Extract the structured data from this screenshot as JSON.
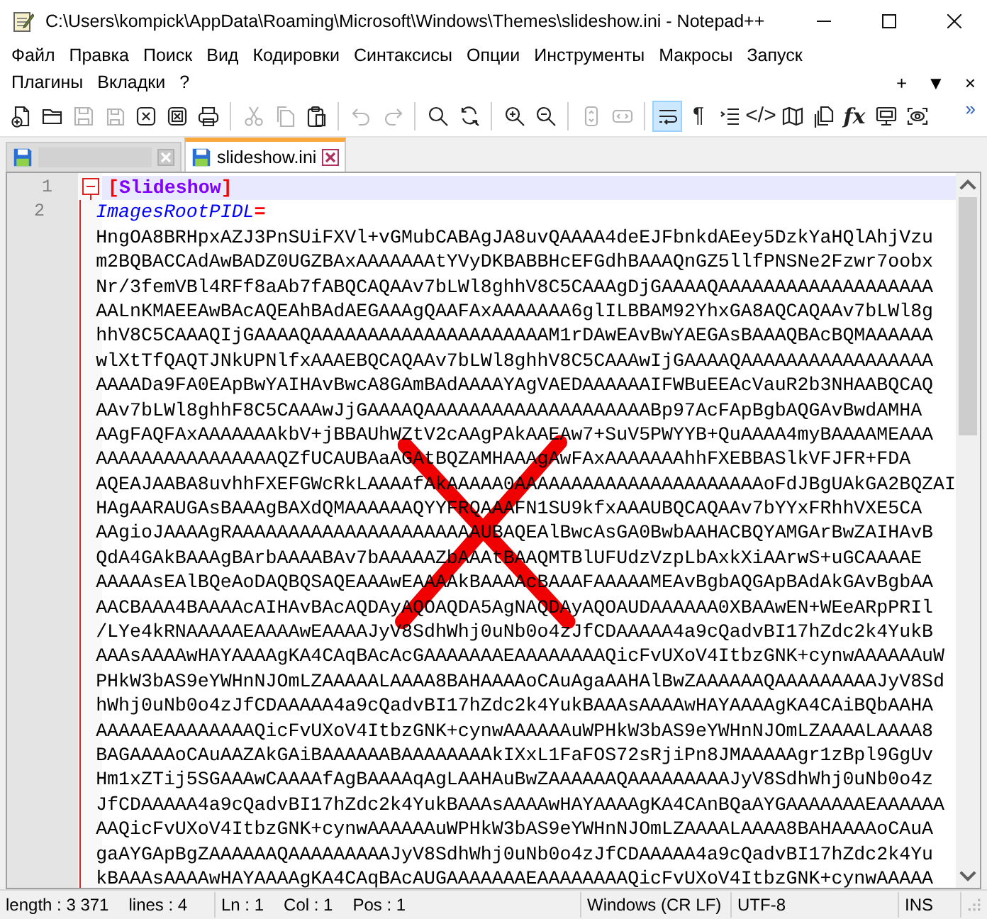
{
  "window": {
    "title": "C:\\Users\\kompick\\AppData\\Roaming\\Microsoft\\Windows\\Themes\\slideshow.ini - Notepad++"
  },
  "menu": {
    "items": [
      "Файл",
      "Правка",
      "Поиск",
      "Вид",
      "Кодировки",
      "Синтаксисы",
      "Опции",
      "Инструменты",
      "Макросы",
      "Запуск",
      "Плагины",
      "Вкладки",
      "?"
    ],
    "controls": [
      "+",
      "▼",
      "×"
    ]
  },
  "toolbar": {
    "items": [
      {
        "kind": "button",
        "disabled": false,
        "selected": false
      },
      {
        "kind": "button",
        "disabled": false,
        "selected": false
      },
      {
        "kind": "button",
        "disabled": true,
        "selected": false
      },
      {
        "kind": "button",
        "disabled": true,
        "selected": false
      },
      {
        "kind": "button",
        "disabled": false,
        "selected": false
      },
      {
        "kind": "button",
        "disabled": false,
        "selected": false
      },
      {
        "kind": "button",
        "disabled": false,
        "selected": false
      },
      {
        "kind": "separator"
      },
      {
        "kind": "button",
        "disabled": true,
        "selected": false
      },
      {
        "kind": "button",
        "disabled": true,
        "selected": false
      },
      {
        "kind": "button",
        "disabled": false,
        "selected": false
      },
      {
        "kind": "separator"
      },
      {
        "kind": "button",
        "disabled": true,
        "selected": false
      },
      {
        "kind": "button",
        "disabled": true,
        "selected": false
      },
      {
        "kind": "separator"
      },
      {
        "kind": "button",
        "disabled": false,
        "selected": false
      },
      {
        "kind": "button",
        "disabled": false,
        "selected": false
      },
      {
        "kind": "separator"
      },
      {
        "kind": "button",
        "disabled": false,
        "selected": false
      },
      {
        "kind": "button",
        "disabled": false,
        "selected": false
      },
      {
        "kind": "separator"
      },
      {
        "kind": "button",
        "disabled": true,
        "selected": false
      },
      {
        "kind": "button",
        "disabled": true,
        "selected": false
      },
      {
        "kind": "separator"
      },
      {
        "kind": "button",
        "disabled": false,
        "selected": true
      },
      {
        "kind": "button",
        "glyph": "¶",
        "disabled": false,
        "selected": false
      },
      {
        "kind": "button",
        "disabled": false,
        "selected": false
      },
      {
        "kind": "button",
        "glyph": "</>",
        "disabled": false,
        "selected": false
      },
      {
        "kind": "button",
        "disabled": false,
        "selected": false
      },
      {
        "kind": "button",
        "disabled": false,
        "selected": false
      },
      {
        "kind": "button",
        "glyph": "fx",
        "disabled": false,
        "selected": false
      },
      {
        "kind": "button",
        "disabled": false,
        "selected": false
      },
      {
        "kind": "button",
        "disabled": false,
        "selected": false
      }
    ],
    "overflow": "»"
  },
  "tabs": [
    {
      "selected": false
    },
    {
      "label": "slideshow.ini",
      "selected": true
    }
  ],
  "editor": {
    "lines": [
      {
        "kind": "section",
        "number": "1",
        "open": "[",
        "section": "Slideshow",
        "close": "]",
        "current": true,
        "expanded": true
      },
      {
        "kind": "entry",
        "number": "2",
        "key": "ImagesRootPIDL",
        "operator": "=",
        "current": false,
        "value_rows": [
          "HngOA8BRHpxAZJ3PnSUiFXVl+vGMubCABAgJA8uvQAAAA4deEJFbnkdAEey5DzkYaHQlAhjVzu",
          "m2BQBACCAdAwBADZ0UGZBAxAAAAAAAtYVyDKBABBHcEFGdhBAAAQnGZ5llfPNSNe2Fzwr7oobx",
          "Nr/3femVBl4RFf8aAb7fABQCAQAAv7bLWl8ghhV8C5CAAAgDjGAAAAQAAAAAAAAAAAAAAAAAAA",
          "AALnKMAEEAwBAcAQEAhBAdAEGAAAgQAAFAxAAAAAAA6glILBBAM92YhxGA8AQCAQAAv7bLWl8g",
          "hhV8C5CAAAQIjGAAAAQAAAAAAAAAAAAAAAAAAAAAM1rDAwEAvBwYAEGAsBAAAQBAcBQMAAAAAA",
          "wlXtTfQAQTJNkUPNlfxAAAEBQCAQAAv7bLWl8ghhV8C5CAAAwIjGAAAAQAAAAAAAAAAAAAAAAA",
          "AAAADa9FA0EApBwYAIHAvBwcA8GAmBAdAAAAYAgVAEDAAAAAAIFWBuEEAcVauR2b3NHAABQCAQ",
          "AAv7bLWl8ghhF8C5CAAAwJjGAAAAQAAAAAAAAAAAAAAAAAAAABp97AcFApBgbAQGAvBwdAMHA",
          "AAgFAQFAxAAAAAAAkbV+jBBAUhWZtV2cAAgPAkAAEAw7+SuV5PWYYB+QuAAAA4myBAAAAMEAAA",
          "AAAAAAAAAAAAAAAAQZfUCAUBAaAGAtBQZAMHAAAgAwFAxAAAAAAAhhFXEBBASlkVFJFR+FDA",
          "AQEAJAABA8uvhhFXEFGWcRkLAAAAfAkAAAAA0AAAAAAAAAAAAAAAAAAAAAAoFdJBgUAkGA2BQZAI",
          "HAgAARAUGAsBAAAgBAXdQMAAAAAAQYYFRQAAAFN1SU9kfxAAAUBQCAQAAv7bYYxFRhhVXE5CA",
          "AAgioJAAAAgRAAAAAAAAAAAAAAAAAAAAAAUBAQEAlBwcAsGA0BwbAAHACBQYAMGArBwZAIHAvB",
          "QdA4GAkBAAAgBArbAAAABAv7bAAAAAZbAAAtBAAQMTBlUFUdzVzpLbAxkXiAArwS+uGCAAAAE",
          "AAAAAsEAlBQeAoDAQBQSAQEAAAwEAAAAkBAAAAcBAAAFAAAAAMEAvBgbAQGApBAdAkGAvBgbAA",
          "AACBAAA4BAAAAcAIHAvBAcAQDAyAQOAQDA5AgNAQDAyAQOAUDAAAAAA0XBAAwEN+WEeARpPRIl",
          "/LYe4kRNAAAAAEAAAAwEAAAAJyV8SdhWhj0uNb0o4zJfCDAAAAA4a9cQadvBI17hZdc2k4YukB",
          "AAAsAAAAwHAYAAAAgKA4CAqBAcAcGAAAAAAAEAAAAAAAAQicFvUXoV4ItbzGNK+cynwAAAAAAuW",
          "PHkW3bAS9eYWHnNJOmLZAAAAALAAAA8BAHAAAAoCAuAgaAAHAlBwZAAAAAAQAAAAAAAAAJyV8Sd",
          "hWhj0uNb0o4zJfCDAAAAA4a9cQadvBI17hZdc2k4YukBAAAsAAAAwHAYAAAAgKA4CAiBQbAAHA",
          "AAAAAEAAAAAAAAQicFvUXoV4ItbzGNK+cynwAAAAAAuWPHkW3bAS9eYWHnNJOmLZAAAALAAAA8",
          "BAGAAAAoCAuAAZAkGAiBAAAAAABAAAAAAAAkIXxL1FaFOS72sRjiPn8JMAAAAAgr1zBpl9GgUv",
          "Hm1xZTij5SGAAAwCAAAAfAgBAAAAqAgLAAHAuBwZAAAAAAQAAAAAAAAAJyV8SdhWhj0uNb0o4z",
          "JfCDAAAAA4a9cQadvBI17hZdc2k4YukBAAAsAAAAwHAYAAAAgKA4CAnBQaAYGAAAAAAAEAAAAAA",
          "AAQicFvUXoV4ItbzGNK+cynwAAAAAAuWPHkW3bAS9eYWHnNJOmLZAAAALAAAA8BAHAAAAoCAuA",
          "gaAYGApBgZAAAAAAQAAAAAAAAAJyV8SdhWhj0uNb0o4zJfCDAAAAA4a9cQadvBI17hZdc2k4Yu",
          "kBAAAsAAAAwHAYAAAAgKA4CAqBAcAUGAAAAAAAEAAAAAAAAQicFvUXoV4ItbzGNK+cynwAAAAA"
        ]
      }
    ]
  },
  "status_bar": {
    "sections": [
      {
        "items": [
          "length : 3 371",
          "lines : 4"
        ]
      },
      {
        "items": [
          "Ln : 1",
          "Col : 1",
          "Pos : 1"
        ]
      },
      {
        "items": [
          "Windows (CR LF)"
        ]
      },
      {
        "items": [
          "UTF-8"
        ]
      },
      {
        "items": [
          "INS"
        ]
      }
    ]
  }
}
